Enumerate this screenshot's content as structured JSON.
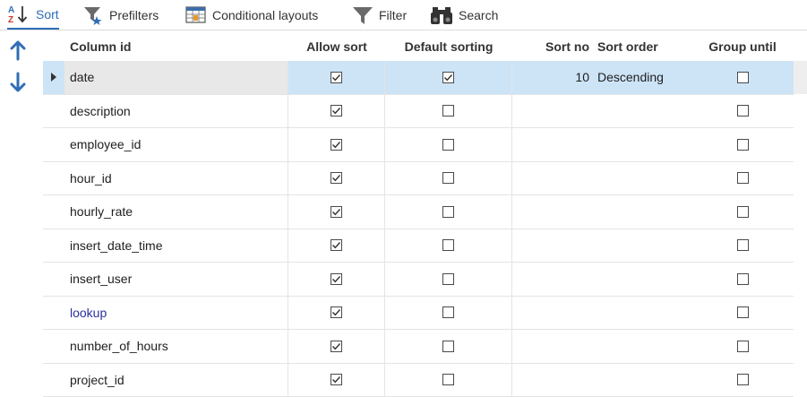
{
  "toolbar": {
    "tabs": [
      {
        "label": "Sort",
        "icon": "sort-az-icon",
        "active": true
      },
      {
        "label": "Prefilters",
        "icon": "prefilter-icon",
        "active": false
      },
      {
        "label": "Conditional layouts",
        "icon": "conditional-layout-icon",
        "active": false
      },
      {
        "label": "Filter",
        "icon": "funnel-icon",
        "active": false
      },
      {
        "label": "Search",
        "icon": "binoculars-icon",
        "active": false
      }
    ]
  },
  "side": {
    "up_icon": "arrow-up-icon",
    "down_icon": "arrow-down-icon"
  },
  "grid": {
    "headers": {
      "column_id": "Column id",
      "allow_sort": "Allow sort",
      "default_sorting": "Default sorting",
      "sort_no": "Sort no",
      "sort_order": "Sort order",
      "group_until": "Group until"
    },
    "rows": [
      {
        "name": "date",
        "allow_sort": true,
        "default_sorting": true,
        "sort_no": "10",
        "sort_order": "Descending",
        "group_until": false,
        "selected": true,
        "link": false
      },
      {
        "name": "description",
        "allow_sort": true,
        "default_sorting": false,
        "sort_no": "",
        "sort_order": "",
        "group_until": false,
        "selected": false,
        "link": false
      },
      {
        "name": "employee_id",
        "allow_sort": true,
        "default_sorting": false,
        "sort_no": "",
        "sort_order": "",
        "group_until": false,
        "selected": false,
        "link": false
      },
      {
        "name": "hour_id",
        "allow_sort": true,
        "default_sorting": false,
        "sort_no": "",
        "sort_order": "",
        "group_until": false,
        "selected": false,
        "link": false
      },
      {
        "name": "hourly_rate",
        "allow_sort": true,
        "default_sorting": false,
        "sort_no": "",
        "sort_order": "",
        "group_until": false,
        "selected": false,
        "link": false
      },
      {
        "name": "insert_date_time",
        "allow_sort": true,
        "default_sorting": false,
        "sort_no": "",
        "sort_order": "",
        "group_until": false,
        "selected": false,
        "link": false
      },
      {
        "name": "insert_user",
        "allow_sort": true,
        "default_sorting": false,
        "sort_no": "",
        "sort_order": "",
        "group_until": false,
        "selected": false,
        "link": false
      },
      {
        "name": "lookup",
        "allow_sort": true,
        "default_sorting": false,
        "sort_no": "",
        "sort_order": "",
        "group_until": false,
        "selected": false,
        "link": true
      },
      {
        "name": "number_of_hours",
        "allow_sort": true,
        "default_sorting": false,
        "sort_no": "",
        "sort_order": "",
        "group_until": false,
        "selected": false,
        "link": false
      },
      {
        "name": "project_id",
        "allow_sort": true,
        "default_sorting": false,
        "sort_no": "",
        "sort_order": "",
        "group_until": false,
        "selected": false,
        "link": false
      }
    ]
  },
  "colors": {
    "accent": "#2f6db5",
    "selection": "#cde4f7",
    "link": "#2b2fa0"
  }
}
